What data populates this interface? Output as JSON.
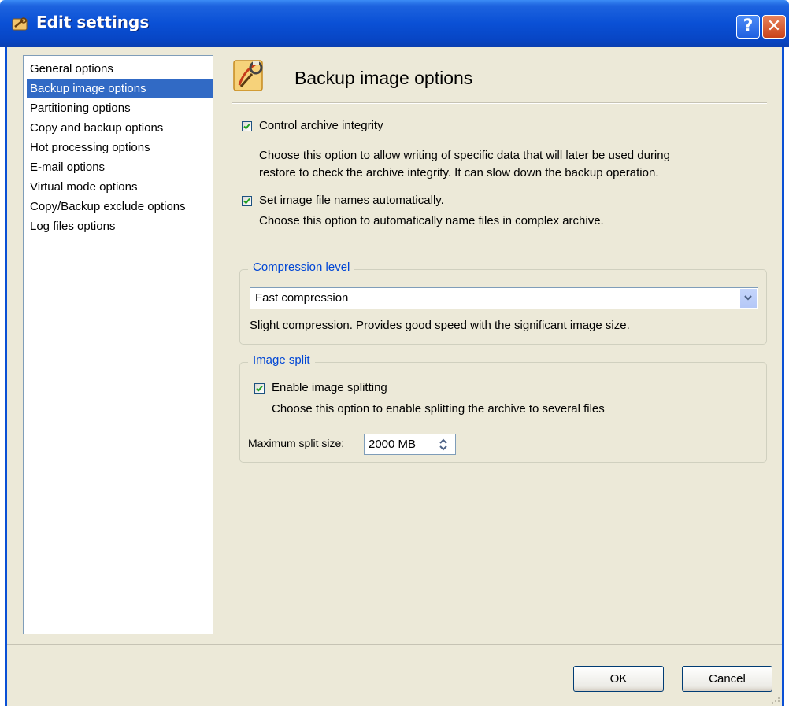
{
  "window": {
    "title": "Edit settings",
    "help_symbol": "?",
    "close_symbol": "✕"
  },
  "sidebar": {
    "items": [
      {
        "label": "General options",
        "selected": false
      },
      {
        "label": "Backup image options",
        "selected": true
      },
      {
        "label": "Partitioning options",
        "selected": false
      },
      {
        "label": "Copy and backup options",
        "selected": false
      },
      {
        "label": "Hot processing options",
        "selected": false
      },
      {
        "label": "E-mail options",
        "selected": false
      },
      {
        "label": "Virtual mode options",
        "selected": false
      },
      {
        "label": "Copy/Backup exclude options",
        "selected": false
      },
      {
        "label": "Log files options",
        "selected": false
      }
    ]
  },
  "panel": {
    "title": "Backup image options",
    "icon": "settings-wrench-icon",
    "control_integrity": {
      "label": "Control archive integrity",
      "checked": true,
      "description_line1": "Choose this option to allow writing of specific data that will later be used during",
      "description_line2": "restore to check the archive integrity. It can slow down the backup operation."
    },
    "auto_names": {
      "label": "Set image file names automatically.",
      "checked": true,
      "description": "Choose this option to automatically name files in complex archive."
    },
    "compression": {
      "legend": "Compression level",
      "selected": "Fast compression",
      "description": "Slight compression. Provides good speed with the significant image size."
    },
    "split": {
      "legend": "Image split",
      "enable_label": "Enable image splitting",
      "enabled": true,
      "description": "Choose this option to enable splitting the archive to several files",
      "max_label": "Maximum split size:",
      "max_value": "2000 MB"
    }
  },
  "footer": {
    "ok_label": "OK",
    "cancel_label": "Cancel"
  },
  "colors": {
    "titlebar": "#0a50d5",
    "selection": "#316ac5",
    "group_legend": "#0046d5",
    "dialog_bg": "#ece9d8"
  }
}
